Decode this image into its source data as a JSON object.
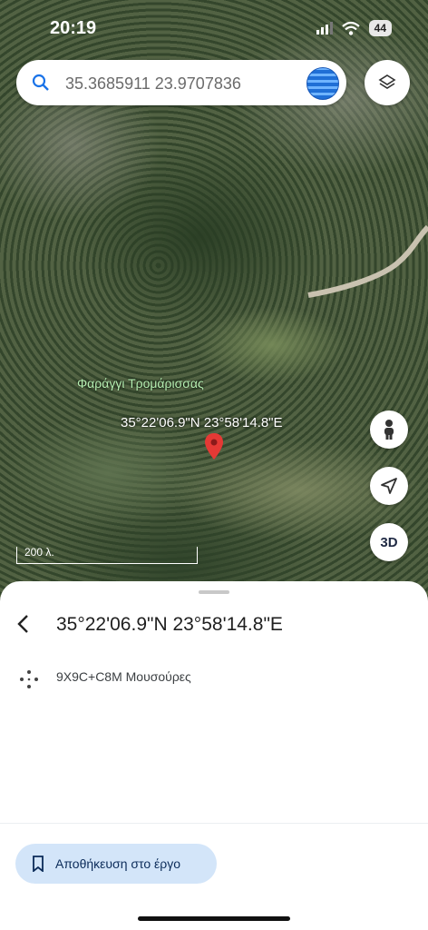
{
  "status_bar": {
    "time": "20:19",
    "battery": "44"
  },
  "search": {
    "value": "35.3685911 23.9707836"
  },
  "map": {
    "place_label": "Φαράγγι Τρομάρισσας",
    "pin_label": "35°22'06.9\"N 23°58'14.8\"E",
    "scale_label": "200 λ.",
    "three_d_label": "3D"
  },
  "sheet": {
    "title": "35°22'06.9\"N 23°58'14.8\"E",
    "plus_code": "9X9C+C8M Μουσούρες",
    "save_label": "Αποθήκευση στο έργο"
  },
  "colors": {
    "pin": "#e53935",
    "accent": "#d3e5f9",
    "brand_text": "#0b2b59"
  }
}
